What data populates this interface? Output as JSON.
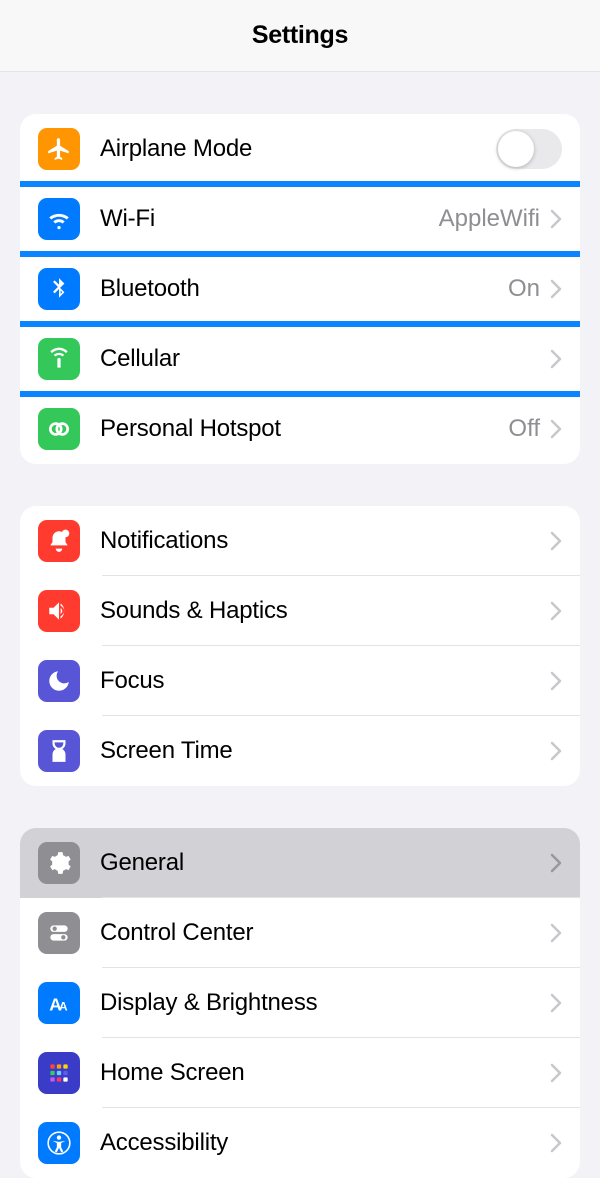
{
  "header": {
    "title": "Settings"
  },
  "groups": [
    {
      "items": [
        {
          "label": "Airplane Mode",
          "icon": "airplane",
          "iconBg": "#ff9500",
          "control": "toggle",
          "toggle": false
        },
        {
          "label": "Wi-Fi",
          "icon": "wifi",
          "iconBg": "#007aff",
          "value": "AppleWifi",
          "highlighted": true
        },
        {
          "label": "Bluetooth",
          "icon": "bluetooth",
          "iconBg": "#007aff",
          "value": "On"
        },
        {
          "label": "Cellular",
          "icon": "cellular",
          "iconBg": "#34c759",
          "highlighted": true
        },
        {
          "label": "Personal Hotspot",
          "icon": "hotspot",
          "iconBg": "#34c759",
          "value": "Off"
        }
      ]
    },
    {
      "items": [
        {
          "label": "Notifications",
          "icon": "notifications",
          "iconBg": "#ff3b30"
        },
        {
          "label": "Sounds & Haptics",
          "icon": "sounds",
          "iconBg": "#ff3b30"
        },
        {
          "label": "Focus",
          "icon": "focus",
          "iconBg": "#5856d6"
        },
        {
          "label": "Screen Time",
          "icon": "screentime",
          "iconBg": "#5856d6"
        }
      ]
    },
    {
      "items": [
        {
          "label": "General",
          "icon": "general",
          "iconBg": "#8e8e93",
          "selected": true
        },
        {
          "label": "Control Center",
          "icon": "controlcenter",
          "iconBg": "#8e8e93"
        },
        {
          "label": "Display & Brightness",
          "icon": "display",
          "iconBg": "#007aff"
        },
        {
          "label": "Home Screen",
          "icon": "homescreen",
          "iconBg": "#3a3cc7"
        },
        {
          "label": "Accessibility",
          "icon": "accessibility",
          "iconBg": "#007aff"
        }
      ]
    }
  ]
}
